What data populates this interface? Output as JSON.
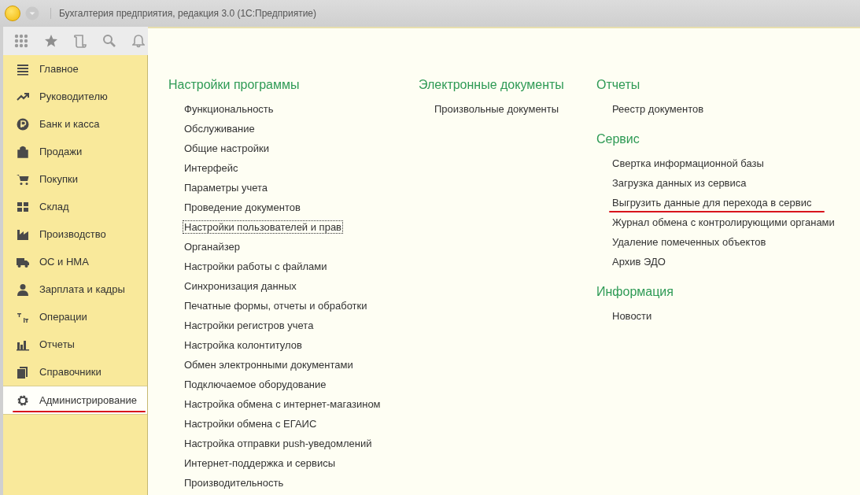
{
  "window": {
    "title": "Бухгалтерия предприятия, редакция 3.0  (1С:Предприятие)"
  },
  "sidebar": {
    "items": [
      {
        "label": "Главное",
        "selected": false,
        "underlined": false
      },
      {
        "label": "Руководителю",
        "selected": false,
        "underlined": false
      },
      {
        "label": "Банк и касса",
        "selected": false,
        "underlined": false
      },
      {
        "label": "Продажи",
        "selected": false,
        "underlined": false
      },
      {
        "label": "Покупки",
        "selected": false,
        "underlined": false
      },
      {
        "label": "Склад",
        "selected": false,
        "underlined": false
      },
      {
        "label": "Производство",
        "selected": false,
        "underlined": false
      },
      {
        "label": "ОС и НМА",
        "selected": false,
        "underlined": false
      },
      {
        "label": "Зарплата и кадры",
        "selected": false,
        "underlined": false
      },
      {
        "label": "Операции",
        "selected": false,
        "underlined": false
      },
      {
        "label": "Отчеты",
        "selected": false,
        "underlined": false
      },
      {
        "label": "Справочники",
        "selected": false,
        "underlined": false
      },
      {
        "label": "Администрирование",
        "selected": true,
        "underlined": true
      }
    ]
  },
  "columns": [
    [
      {
        "title": "Настройки программы",
        "items": [
          {
            "label": "Функциональность",
            "focused": false,
            "underlined": false
          },
          {
            "label": "Обслуживание",
            "focused": false,
            "underlined": false
          },
          {
            "label": "Общие настройки",
            "focused": false,
            "underlined": false
          },
          {
            "label": "Интерфейс",
            "focused": false,
            "underlined": false
          },
          {
            "label": "Параметры учета",
            "focused": false,
            "underlined": false
          },
          {
            "label": "Проведение документов",
            "focused": false,
            "underlined": false
          },
          {
            "label": "Настройки пользователей и прав",
            "focused": true,
            "underlined": false
          },
          {
            "label": "Органайзер",
            "focused": false,
            "underlined": false
          },
          {
            "label": "Настройки работы с файлами",
            "focused": false,
            "underlined": false
          },
          {
            "label": "Синхронизация данных",
            "focused": false,
            "underlined": false
          },
          {
            "label": "Печатные формы, отчеты и обработки",
            "focused": false,
            "underlined": false
          },
          {
            "label": "Настройки регистров учета",
            "focused": false,
            "underlined": false
          },
          {
            "label": "Настройка колонтитулов",
            "focused": false,
            "underlined": false
          },
          {
            "label": "Обмен электронными документами",
            "focused": false,
            "underlined": false
          },
          {
            "label": "Подключаемое оборудование",
            "focused": false,
            "underlined": false
          },
          {
            "label": "Настройка обмена с интернет-магазином",
            "focused": false,
            "underlined": false
          },
          {
            "label": "Настройки обмена с ЕГАИС",
            "focused": false,
            "underlined": false
          },
          {
            "label": "Настройка отправки push-уведомлений",
            "focused": false,
            "underlined": false
          },
          {
            "label": "Интернет-поддержка и сервисы",
            "focused": false,
            "underlined": false
          },
          {
            "label": "Производительность",
            "focused": false,
            "underlined": false
          }
        ]
      }
    ],
    [
      {
        "title": "Электронные документы",
        "items": [
          {
            "label": "Произвольные документы",
            "focused": false,
            "underlined": false
          }
        ]
      }
    ],
    [
      {
        "title": "Отчеты",
        "items": [
          {
            "label": "Реестр документов",
            "focused": false,
            "underlined": false
          }
        ]
      },
      {
        "title": "Сервис",
        "items": [
          {
            "label": "Свертка информационной базы",
            "focused": false,
            "underlined": false
          },
          {
            "label": "Загрузка данных из сервиса",
            "focused": false,
            "underlined": false
          },
          {
            "label": "Выгрузить данные для перехода в сервис",
            "focused": false,
            "underlined": true
          },
          {
            "label": "Журнал обмена с контролирующими органами",
            "focused": false,
            "underlined": false
          },
          {
            "label": "Удаление помеченных объектов",
            "focused": false,
            "underlined": false
          },
          {
            "label": "Архив ЭДО",
            "focused": false,
            "underlined": false
          }
        ]
      },
      {
        "title": "Информация",
        "items": [
          {
            "label": "Новости",
            "focused": false,
            "underlined": false
          }
        ]
      }
    ]
  ]
}
